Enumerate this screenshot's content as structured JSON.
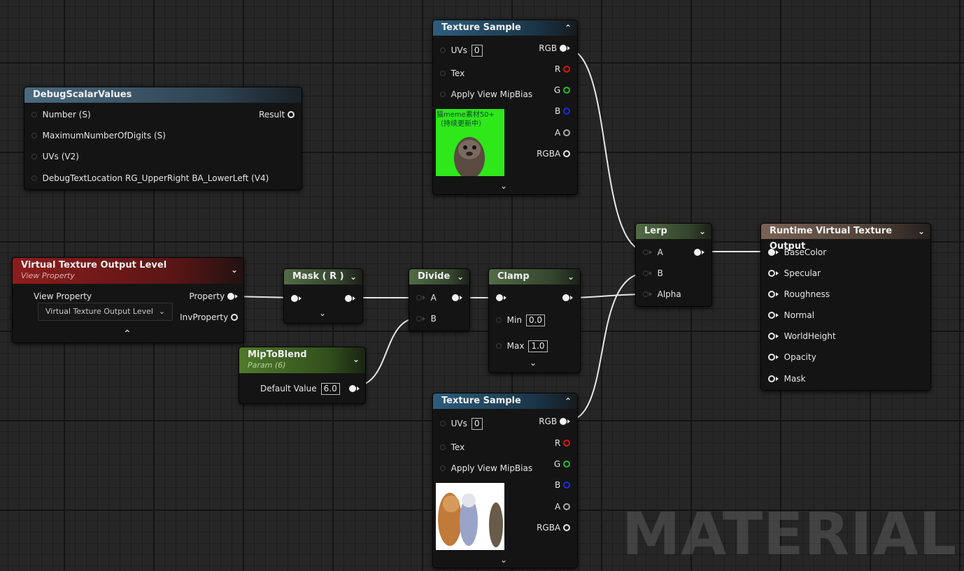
{
  "watermark": "MATERIAL",
  "nodes": {
    "debug": {
      "title": "DebugScalarValues",
      "inputs": [
        "Number (S)",
        "MaximumNumberOfDigits (S)",
        "UVs (V2)",
        "DebugTextLocation RG_UpperRight BA_LowerLeft (V4)"
      ],
      "output": "Result"
    },
    "vtol": {
      "title": "Virtual Texture Output Level",
      "subtitle": "View Property",
      "label": "View Property",
      "combo": "Virtual Texture Output Level",
      "out1": "Property",
      "out2": "InvProperty"
    },
    "mask": {
      "title": "Mask ( R )"
    },
    "divide": {
      "title": "Divide",
      "inA": "A",
      "inB": "B"
    },
    "clamp": {
      "title": "Clamp",
      "min_label": "Min",
      "min_val": "0.0",
      "max_label": "Max",
      "max_val": "1.0"
    },
    "mip": {
      "title": "MipToBlend",
      "subtitle": "Param (6)",
      "label": "Default Value",
      "value": "6.0"
    },
    "ts1": {
      "title": "Texture Sample",
      "uv_label": "UVs",
      "uv_val": "0",
      "tex": "Tex",
      "mip": "Apply View MipBias",
      "outs": [
        "RGB",
        "R",
        "G",
        "B",
        "A",
        "RGBA"
      ],
      "thumb_text": "猫meme素材50+（持续更新中）"
    },
    "ts2": {
      "title": "Texture Sample",
      "uv_label": "UVs",
      "uv_val": "0",
      "tex": "Tex",
      "mip": "Apply View MipBias",
      "outs": [
        "RGB",
        "R",
        "G",
        "B",
        "A",
        "RGBA"
      ]
    },
    "lerp": {
      "title": "Lerp",
      "inputs": [
        "A",
        "B",
        "Alpha"
      ]
    },
    "rvto": {
      "title": "Runtime Virtual Texture Output",
      "inputs": [
        "BaseColor",
        "Specular",
        "Roughness",
        "Normal",
        "WorldHeight",
        "Opacity",
        "Mask"
      ]
    }
  },
  "colors": {
    "pin_r": "#e01010",
    "pin_g": "#20c020",
    "pin_b": "#1a2ee0",
    "green_screen": "#2ee81a"
  }
}
